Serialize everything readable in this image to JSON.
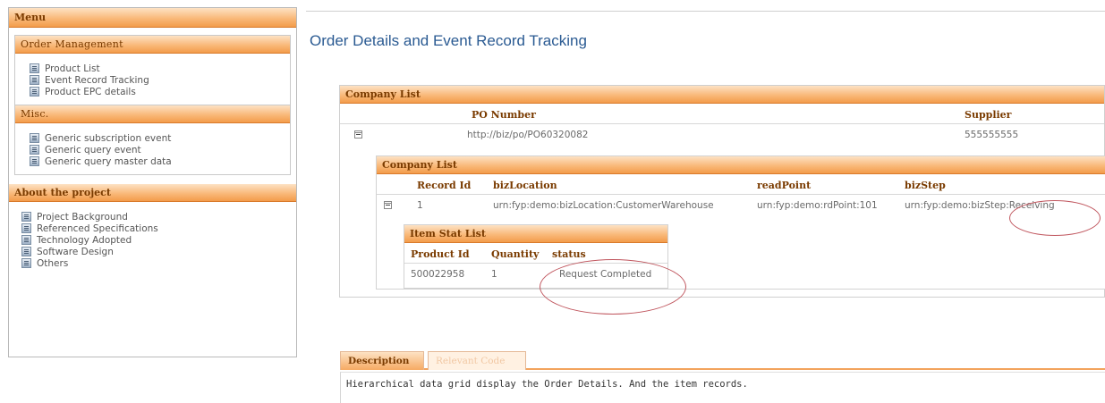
{
  "sidebar": {
    "menu_title": "Menu",
    "order_management": {
      "title": "Order Management",
      "items": [
        {
          "label": "Product List",
          "icon": "document-icon"
        },
        {
          "label": "Event Record Tracking",
          "icon": "document-icon"
        },
        {
          "label": "Product EPC details",
          "icon": "document-icon"
        }
      ]
    },
    "misc": {
      "title": "Misc.",
      "items": [
        {
          "label": "Generic subscription event",
          "icon": "document-icon"
        },
        {
          "label": "Generic query event",
          "icon": "document-icon"
        },
        {
          "label": "Generic query master data",
          "icon": "document-icon"
        }
      ]
    },
    "about": {
      "title": "About the project",
      "items": [
        {
          "label": "Project Background",
          "icon": "document-icon"
        },
        {
          "label": "Referenced Specifications",
          "icon": "document-icon"
        },
        {
          "label": "Technology Adopted",
          "icon": "document-icon"
        },
        {
          "label": "Software Design",
          "icon": "document-icon"
        },
        {
          "label": "Others",
          "icon": "document-icon"
        }
      ]
    }
  },
  "main": {
    "title": "Order Details and Event Record Tracking",
    "company_grid": {
      "title": "Company List",
      "columns": [
        "PO Number",
        "Supplier"
      ],
      "row": {
        "po_number": "http://biz/po/PO60320082",
        "supplier": "555555555"
      },
      "nested": {
        "title": "Company List",
        "columns": [
          "Record Id",
          "bizLocation",
          "readPoint",
          "bizStep"
        ],
        "row": {
          "record_id": "1",
          "biz_location": "urn:fyp:demo:bizLocation:CustomerWarehouse",
          "read_point": "urn:fyp:demo:rdPoint:101",
          "biz_step": "urn:fyp:demo:bizStep:Receiving"
        },
        "item_stat": {
          "title": "Item Stat List",
          "columns": [
            "Product Id",
            "Quantity",
            "status"
          ],
          "row": {
            "product_id": "500022958",
            "quantity": "1",
            "status": "Request Completed"
          }
        }
      }
    },
    "description": {
      "tabs": [
        "Description",
        "Relevant Code"
      ],
      "text": "Hierarchical data grid display the Order Details. And the item records."
    }
  },
  "colors": {
    "accent_orange": "#f39c4b",
    "title_blue": "#2a5a92",
    "header_text": "#7a3b00",
    "annotation_red": "#c0565e"
  }
}
